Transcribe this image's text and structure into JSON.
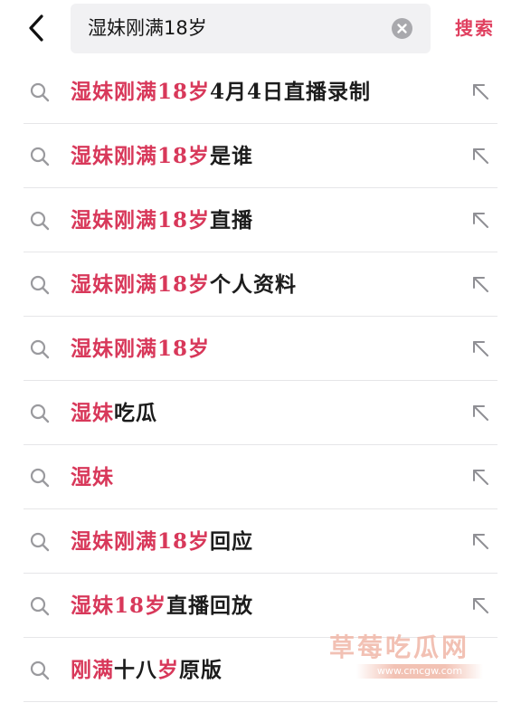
{
  "header": {
    "query": "湿妹刚满18岁",
    "search_label": "搜索"
  },
  "suggestions": [
    {
      "highlight": "湿妹刚满18岁",
      "rest": "4月4日直播录制"
    },
    {
      "highlight": "湿妹刚满18岁",
      "rest": "是谁"
    },
    {
      "highlight": "湿妹刚满18岁",
      "rest": "直播"
    },
    {
      "highlight": "湿妹刚满18岁",
      "rest": "个人资料"
    },
    {
      "highlight": "湿妹刚满18岁",
      "rest": ""
    },
    {
      "highlight": "湿妹",
      "rest": "吃瓜"
    },
    {
      "highlight": "湿妹",
      "rest": ""
    },
    {
      "highlight": "湿妹刚满18岁",
      "rest": "回应"
    },
    {
      "highlight": "湿妹18岁",
      "rest": "直播回放"
    },
    {
      "parts": [
        {
          "text": "刚满",
          "hl": true
        },
        {
          "text": "十八",
          "hl": false
        },
        {
          "text": "岁",
          "hl": true
        },
        {
          "text": "原版",
          "hl": false
        }
      ]
    }
  ],
  "watermark": {
    "title": "草莓吃瓜网",
    "url": "www.cmcgw.com"
  },
  "colors": {
    "accent": "#d8385a",
    "search_button": "#e04060",
    "search_box_bg": "#f1f1f3",
    "icon_gray": "#a9a9ad"
  },
  "icons": {
    "back": "chevron-left-icon",
    "clear": "clear-circle-x-icon",
    "suggestion": "search-icon",
    "fill": "arrow-up-left-icon"
  }
}
